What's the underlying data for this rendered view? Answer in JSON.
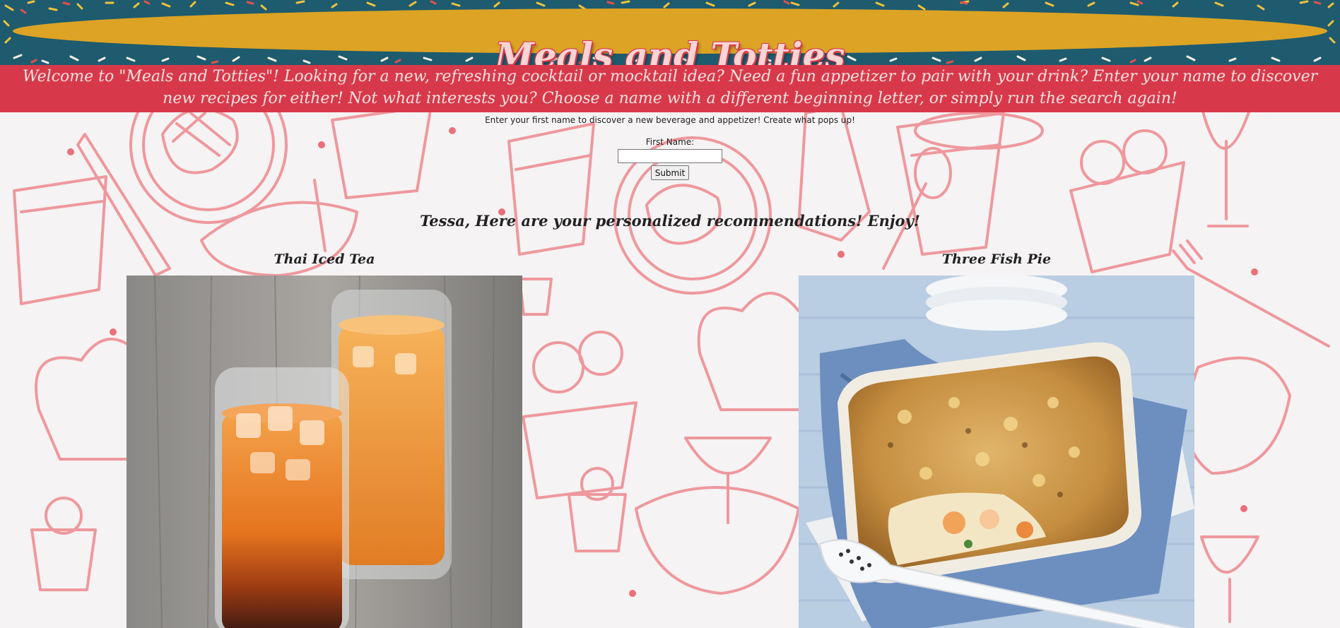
{
  "site": {
    "title": "Meals and Totties",
    "welcome": "Welcome to \"Meals and Totties\"! Looking for a new, refreshing cocktail or mocktail idea? Need a fun appetizer to pair with your drink? Enter your name to discover new recipes for either! Not what interests you? Choose a name with a different beginning letter, or simply run the search again!"
  },
  "form": {
    "intro": "Enter your first name to discover a new beverage and appetizer! Create what pops up!",
    "label": "First Name:",
    "value": "",
    "submit_label": "Submit"
  },
  "results": {
    "heading": "Tessa, Here are your personalized recommendations! Enjoy!",
    "beverage": {
      "title": "Thai Iced Tea",
      "image": "thai-iced-tea-photo"
    },
    "appetizer": {
      "title": "Three Fish Pie",
      "image": "three-fish-pie-photo"
    }
  },
  "colors": {
    "banner_teal": "#1e5b6e",
    "banner_gold": "#dca324",
    "welcome_red": "#d8394a",
    "doodle_pink": "#ee8f95",
    "page_bg": "#f5f3f3"
  }
}
